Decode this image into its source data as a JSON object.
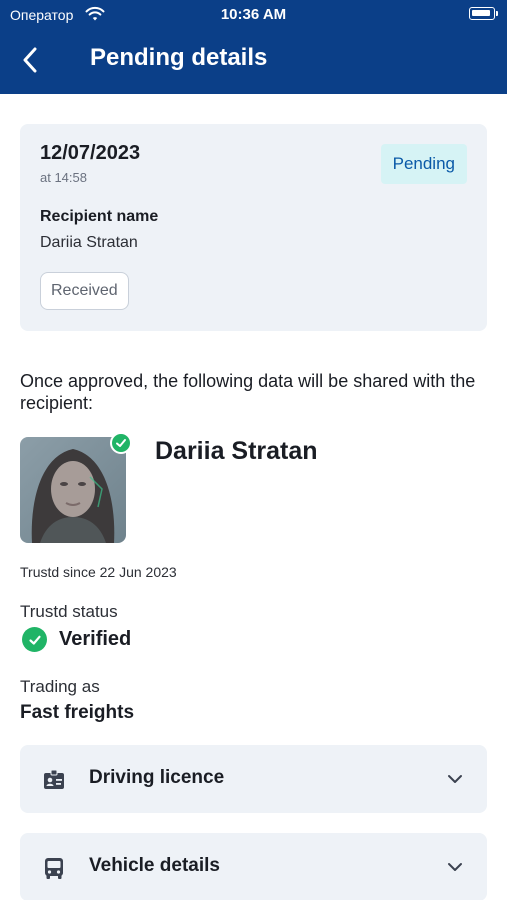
{
  "status_bar": {
    "carrier": "Оператор",
    "time": "10:36 AM"
  },
  "header": {
    "title": "Pending details"
  },
  "request": {
    "date": "12/07/2023",
    "time": "at 14:58",
    "badge": "Pending",
    "recipient_label": "Recipient name",
    "recipient_name": "Dariia Stratan",
    "chip": "Received"
  },
  "shared": {
    "intro": "Once approved, the following data will be shared with the recipient:",
    "name": "Dariia Stratan",
    "since": "Trustd since 22 Jun 2023",
    "status_label": "Trustd status",
    "status_value": "Verified",
    "trading_label": "Trading as",
    "trading_value": "Fast freights"
  },
  "accordions": [
    {
      "label": "Driving licence",
      "icon": "id-card-icon"
    },
    {
      "label": "Vehicle details",
      "icon": "bus-icon"
    }
  ],
  "colors": {
    "header": "#0b3f88",
    "accent": "#0b5aa8",
    "success": "#20b466",
    "card": "#eef2f7"
  }
}
